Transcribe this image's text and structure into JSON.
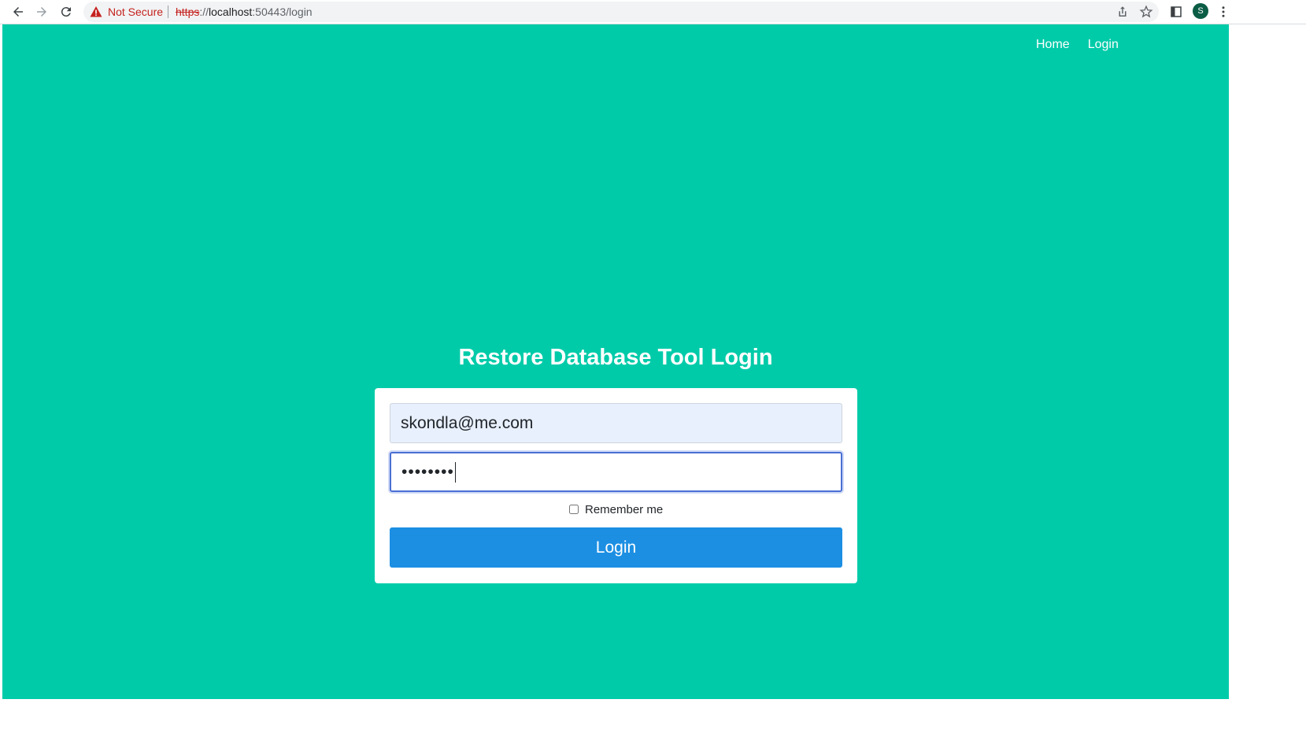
{
  "browser": {
    "security_label": "Not Secure",
    "url_scheme": "https",
    "url_separator": "://",
    "url_host": "localhost",
    "url_rest": ":50443/login",
    "profile_initial": "S",
    "icons": [
      "back-arrow-icon",
      "forward-arrow-icon",
      "reload-icon",
      "warning-icon",
      "share-icon",
      "star-icon",
      "side-panel-icon",
      "more-vert-icon"
    ]
  },
  "nav": {
    "items": [
      {
        "label": "Home"
      },
      {
        "label": "Login"
      }
    ]
  },
  "login": {
    "title": "Restore Database Tool Login",
    "email_value": "skondla@me.com",
    "password_masked": "••••••••",
    "remember_label": "Remember me",
    "remember_checked": false,
    "submit_label": "Login"
  },
  "colors": {
    "page_background": "#00cba9",
    "button": "#1c8fe3",
    "autofill": "#e8f0fe"
  }
}
